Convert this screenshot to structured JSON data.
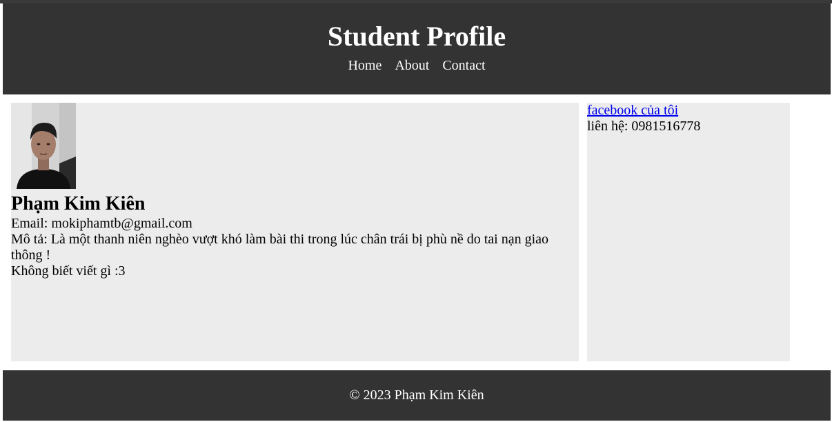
{
  "header": {
    "title": "Student Profile",
    "nav": [
      "Home",
      "About",
      "Contact"
    ]
  },
  "profile": {
    "photo_icon": "profile-photo",
    "name": "Phạm Kim Kiên",
    "email_line": "Email: mokiphamtb@gmail.com",
    "description_line": "Mô tả: Là một thanh niên nghèo vượt khó làm bài thi trong lúc chân trái bị phù nề do tai nạn giao thông !",
    "extra_line": "Không biết viết gì :3"
  },
  "sidebar": {
    "facebook_link": "facebook của tôi",
    "contact_line": "liên hệ: 0981516778"
  },
  "footer": {
    "text": "© 2023 Phạm Kim Kiên"
  },
  "colors": {
    "header_bg": "#333333",
    "panel_bg": "#ececec",
    "link": "#0000ee"
  }
}
